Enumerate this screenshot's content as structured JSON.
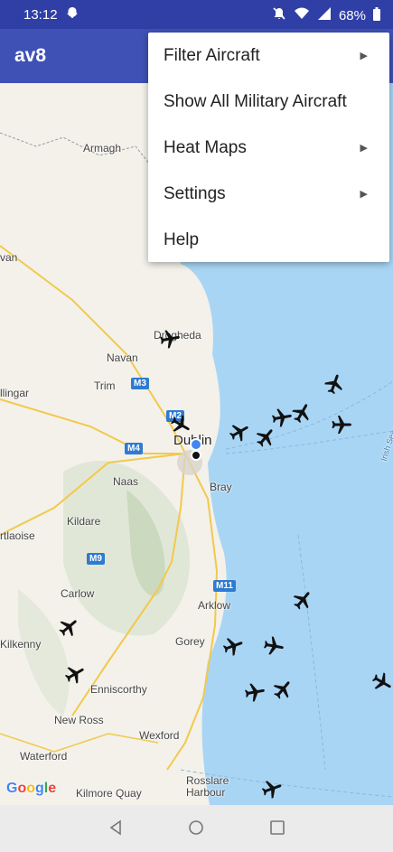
{
  "status": {
    "time": "13:12",
    "battery": "68%"
  },
  "app": {
    "title": "av8"
  },
  "menu": {
    "items": [
      {
        "label": "Filter Aircraft",
        "submenu": true
      },
      {
        "label": "Show All Military Aircraft",
        "submenu": false
      },
      {
        "label": "Heat Maps",
        "submenu": true
      },
      {
        "label": "Settings",
        "submenu": true
      },
      {
        "label": "Help",
        "submenu": false
      }
    ]
  },
  "map": {
    "places": {
      "armagh": "Armagh",
      "van": "van",
      "drogheda": "Drogheda",
      "navan": "Navan",
      "trim": "Trim",
      "llingar": "llingar",
      "dublin": "Dublin",
      "naas": "Naas",
      "bray": "Bray",
      "kildare": "Kildare",
      "rtlaoise": "rtlaoise",
      "carlow": "Carlow",
      "arklow": "Arklow",
      "kilkenny": "Kilkenny",
      "gorey": "Gorey",
      "enniscorthy": "Enniscorthy",
      "newross": "New Ross",
      "wexford": "Wexford",
      "waterford": "Waterford",
      "kilmore": "Kilmore Quay",
      "rosslare": "Rosslare\nHarbour",
      "irishsea": "Irish Sea"
    },
    "roads": {
      "m3": "M3",
      "m2": "M2",
      "m4": "M4",
      "m9": "M9",
      "m11": "M11"
    },
    "google": "Google"
  },
  "colors": {
    "statusbar": "#2f3fa6",
    "appbar": "#3f51b5",
    "sea": "#a9d5f5",
    "land": "#f3f1ea"
  }
}
